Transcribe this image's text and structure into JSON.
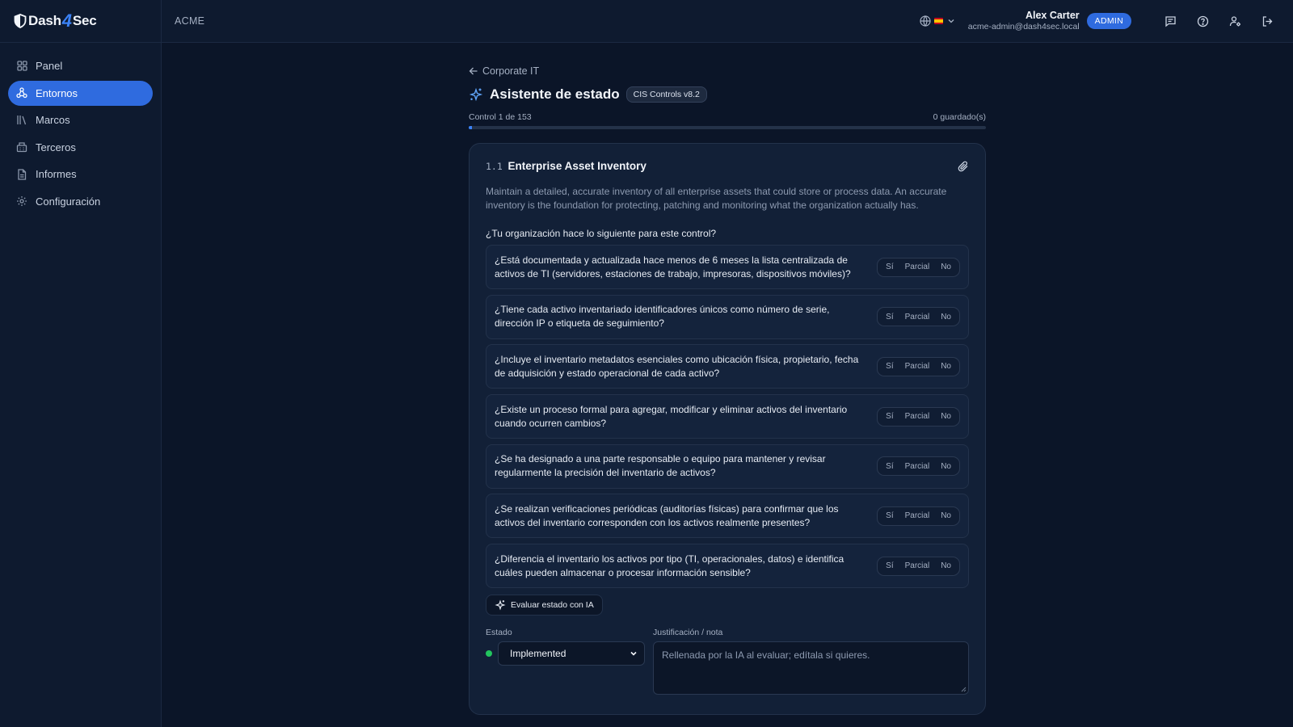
{
  "app": {
    "brand_left": "Dash",
    "brand_mid": "4",
    "brand_right": "Sec",
    "accent_color": "#2f6bdf"
  },
  "sidebar": {
    "items": [
      {
        "label": "Panel",
        "icon": "grid-icon"
      },
      {
        "label": "Entornos",
        "icon": "network-icon",
        "active": true
      },
      {
        "label": "Marcos",
        "icon": "library-icon"
      },
      {
        "label": "Terceros",
        "icon": "building-icon"
      },
      {
        "label": "Informes",
        "icon": "document-icon"
      },
      {
        "label": "Configuración",
        "icon": "gear-icon"
      }
    ]
  },
  "topbar": {
    "org": "ACME",
    "user_name": "Alex Carter",
    "user_email": "acme-admin@dash4sec.local",
    "role_badge": "ADMIN",
    "icons": [
      "globe-icon",
      "spain-flag-icon",
      "chevron-down-icon",
      "messages-icon",
      "help-icon",
      "user-settings-icon",
      "logout-icon"
    ]
  },
  "page": {
    "back_label": "Corporate IT",
    "title": "Asistente de estado",
    "framework_badge": "CIS Controls v8.2",
    "progress_label": "Control 1 de 153",
    "saved_label": "0 guardado(s)",
    "progress_fraction": 0.0065
  },
  "control": {
    "code": "1.1",
    "title": "Enterprise Asset Inventory",
    "description": "Maintain a detailed, accurate inventory of all enterprise assets that could store or process data. An accurate inventory is the foundation for protecting, patching and monitoring what the organization actually has.",
    "prompt": "¿Tu organización hace lo siguiente para este control?",
    "answer_options": [
      "Sí",
      "Parcial",
      "No"
    ],
    "questions": [
      "¿Está documentada y actualizada hace menos de 6 meses la lista centralizada de activos de TI (servidores, estaciones de trabajo, impresoras, dispositivos móviles)?",
      "¿Tiene cada activo inventariado identificadores únicos como número de serie, dirección IP o etiqueta de seguimiento?",
      "¿Incluye el inventario metadatos esenciales como ubicación física, propietario, fecha de adquisición y estado operacional de cada activo?",
      "¿Existe un proceso formal para agregar, modificar y eliminar activos del inventario cuando ocurren cambios?",
      "¿Se ha designado a una parte responsable o equipo para mantener y revisar regularmente la precisión del inventario de activos?",
      "¿Se realizan verificaciones periódicas (auditorías físicas) para confirmar que los activos del inventario corresponden con los activos realmente presentes?",
      "¿Diferencia el inventario los activos por tipo (TI, operacionales, datos) e identifica cuáles pueden almacenar o procesar información sensible?"
    ],
    "ai_button": "Evaluar estado con IA",
    "status_label": "Estado",
    "status_value": "Implemented",
    "status_color": "#22c55e",
    "justification_label": "Justificación / nota",
    "justification_placeholder": "Rellenada por la IA al evaluar; edítala si quieres."
  }
}
